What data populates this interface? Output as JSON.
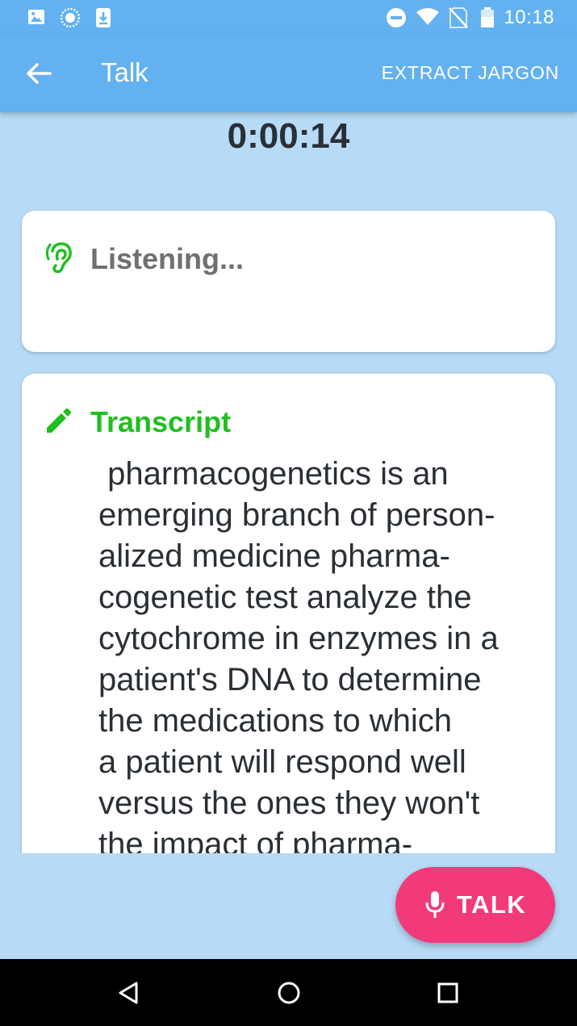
{
  "status_bar": {
    "time": "10:18",
    "icons": [
      "image-icon",
      "sync-icon",
      "download-icon",
      "do-not-disturb-icon",
      "wifi-icon",
      "no-sim-icon",
      "battery-icon"
    ]
  },
  "app_bar": {
    "title": "Talk",
    "action_label": "EXTRACT JARGON",
    "back_icon": "arrow-back-icon"
  },
  "timer": "0:00:14",
  "listening_card": {
    "status_text": "Listening...",
    "icon": "ear-icon",
    "icon_color": "#1fbf1f"
  },
  "transcript_card": {
    "heading": "Transcript",
    "icon": "pencil-icon",
    "heading_color": "#1fbf1f",
    "text": " pharmacogenetics is an\nemerging branch of person-\nalized medicine pharma-\ncogenetic test analyze the\ncytochrome in enzymes in a\npatient's DNA to determine\nthe medications to which\na patient will respond well\nversus the ones they won't\nthe impact of pharma-"
  },
  "talk_button": {
    "label": "TALK",
    "icon": "microphone-icon",
    "color": "#f23a7b"
  },
  "nav_bar": {
    "buttons": [
      "back-triangle-icon",
      "home-circle-icon",
      "recents-square-icon"
    ]
  },
  "colors": {
    "primary": "#63b1f1",
    "background": "#b7dbf6",
    "accent": "#f23a7b",
    "green": "#1fbf1f"
  }
}
